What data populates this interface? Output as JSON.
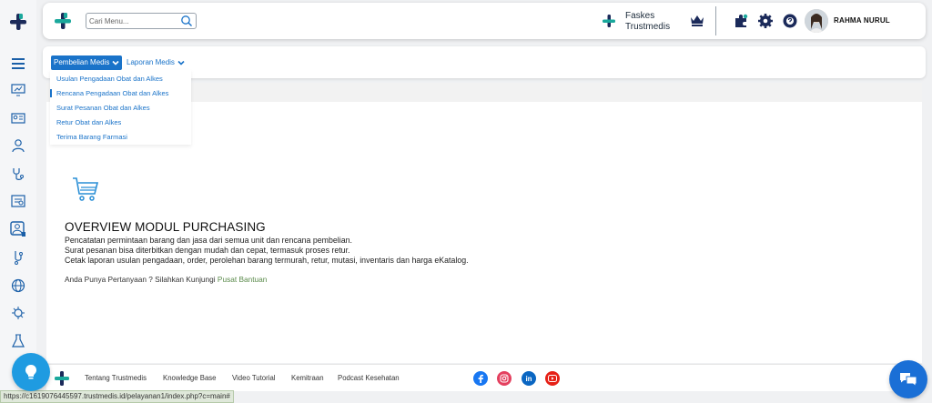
{
  "header": {
    "search_placeholder": "Cari Menu...",
    "facility_line1": "Faskes",
    "facility_line2": "Trustmedis",
    "user_name": "RAHMA NURUL"
  },
  "menu": {
    "active_label": "Pembelian Medis",
    "second_label": "Laporan Medis",
    "dropdown": [
      "Usulan Pengadaan Obat dan Alkes",
      "Rencana Pengadaan Obat dan Alkes",
      "Surat Pesanan Obat dan Alkes",
      "Retur Obat dan Alkes",
      "Terima Barang Farmasi"
    ]
  },
  "overview": {
    "title": "OVERVIEW MODUL PURCHASING",
    "lines": [
      "Pencatatan permintaan barang dan jasa dari semua unit dan rencana pembelian.",
      "Surat pesanan bisa diterbitkan dengan mudah dan cepat, termasuk proses retur.",
      "Cetak laporan usulan pengadaan, order, perolehan barang termurah, retur, mutasi, inventaris dan harga eKatalog."
    ],
    "help_text": "Anda Punya Pertanyaan ? Silahkan Kunjungi",
    "help_link": "Pusat Bantuan"
  },
  "footer": {
    "links": [
      "Tentang Trustmedis",
      "Knowledge Base",
      "Video Tutorial",
      "Kemitraan",
      "Podcast Kesehatan"
    ],
    "social_linkedin": "in"
  },
  "status_url": "https://c1619076445597.trustmedis.id/pelayanan1/index.php?c=main#",
  "colors": {
    "accent": "#1a73c9",
    "brand_green": "#1aa89c",
    "brand_navy": "#1b2a5a",
    "facebook": "#1877f2",
    "instagram": "#e4405f",
    "linkedin": "#0a66c2",
    "youtube": "#e62117"
  }
}
